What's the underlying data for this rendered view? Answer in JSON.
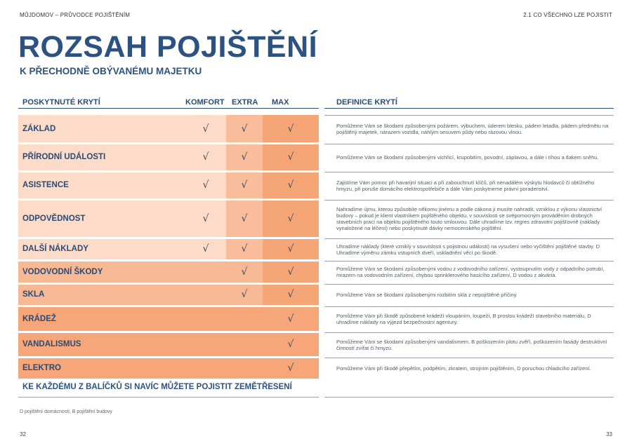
{
  "header": {
    "left": "MŮJDOMOV – PRŮVODCE POJIŠTĚNÍM",
    "right": "2.1 CO VŠECHNO LZE POJISTIT"
  },
  "title": "ROZSAH POJIŠTĚNÍ",
  "subtitle": "K PŘECHODNĚ OBÝVANÉMU MAJETKU",
  "columns": {
    "name": "POSKYTNUTÉ KRYTÍ",
    "komfort": "KOMFORT",
    "extra": "EXTRA",
    "max": "MAX",
    "definition": "DEFINICE KRYTÍ"
  },
  "check_symbol": "√",
  "rows": [
    {
      "name": "ZÁKLAD",
      "tiers": {
        "komfort": true,
        "extra": true,
        "max": true
      },
      "definition": "Pomůžeme Vám se škodami způsobenými požárem, výbuchem, úderem blesku, pádem letadla, pádem předmětu na pojištěný majetek, nárazem vozidla, náhlým sesuvem půdy nebo rázovou vlnou."
    },
    {
      "name": "PŘÍRODNÍ UDÁLOSTI",
      "tiers": {
        "komfort": true,
        "extra": true,
        "max": true
      },
      "definition": "Pomůžeme Vám se škodami způsobenými vichřicí, krupobitím, povodní, záplavou, a dále i tíhou a tlakem sněhu."
    },
    {
      "name": "ASISTENCE",
      "tiers": {
        "komfort": true,
        "extra": true,
        "max": true
      },
      "definition": "Zajistíme Vám pomoc při havarijní situaci a při zabouchnutí klíčů, při nenadálém výskytu hlodavců či obtížného hmyzu, při poruše domácího elektrospotřebiče a dále Vám poskytneme právní poradenství."
    },
    {
      "name": "ODPOVĚDNOST",
      "tiers": {
        "komfort": true,
        "extra": true,
        "max": true
      },
      "definition": "Nahradíme újmu, kterou způsobíte někomu jinému a podle zákona ji musíte nahradit, vzniklou z výkonu vlastnictví budovy – pokud je klient vlastníkem pojištěného objektu, v souvislosti se svépomocným prováděním drobných stavebních prací na objektu pojištěného touto smlouvou. Dále uhradíme tzv. regres zdravotní pojišťovně (náklady vynaložené na léčení) nebo poskytnuté dávky nemocenského pojištění."
    },
    {
      "name": "DALŠÍ NÁKLADY",
      "tiers": {
        "komfort": true,
        "extra": true,
        "max": true
      },
      "definition": "Uhradíme náklady (které vzniklý v souvislosti s pojistnou událostí) na vysušení nebo vyčištění pojištěné stavby. D Uhradíme výměnu zámku vstupních dveří, uskladnění věcí po škodě."
    },
    {
      "name": "VODOVODNÍ ŠKODY",
      "tiers": {
        "komfort": false,
        "extra": true,
        "max": true
      },
      "definition": "Pomůžeme Vám se škodami způsobenými vodou z vodovodního zařízení, vystoupnutím vody z odpadního potrubí, mrazem na vodovodním zařízení, chybou sprinklerového hasicího zařízení, D vodou z akvária."
    },
    {
      "name": "SKLA",
      "tiers": {
        "komfort": false,
        "extra": true,
        "max": true
      },
      "definition": "Pomůžeme Vám se škodami způsobenými rozbitím skla z nepojištěné příčiny."
    },
    {
      "name": "KRÁDEŽ",
      "tiers": {
        "komfort": false,
        "extra": false,
        "max": true
      },
      "definition": "Pomůžeme Vám při škodě způsobené krádeží vloupáním, loupeží, B prostou krádeží stavebního materiálu, D uhradíme náklady na výjezd bezpečnostní agentury."
    },
    {
      "name": "VANDALISMUS",
      "tiers": {
        "komfort": false,
        "extra": false,
        "max": true
      },
      "definition": "Pomůžeme Vám se škodami způsobenými vandalismem, B poškozením plotu zvěří, poškozením fasády destruktivní činností zvířat či hmyzu."
    },
    {
      "name": "ELEKTRO",
      "tiers": {
        "komfort": false,
        "extra": false,
        "max": true
      },
      "definition": "Pomůžeme Vám při škodě přepětím, podpětím, zkratem, strojním pojištěním, D poruchou chladicího zařízení."
    }
  ],
  "footer_line": "KE KAŽDÉMU Z BALÍČKŮ SI NAVÍC MŮŽETE POJISTIT ZEMĚTŘESENÍ",
  "note": "D pojištění domácnosti, B pojištění budovy",
  "page_left": "32",
  "page_right": "33",
  "colors": {
    "navy": "#2b4a73",
    "tier_light": "#fcdcc8",
    "tier_mid": "#f9bd9b",
    "tier_dark": "#f6a577"
  }
}
